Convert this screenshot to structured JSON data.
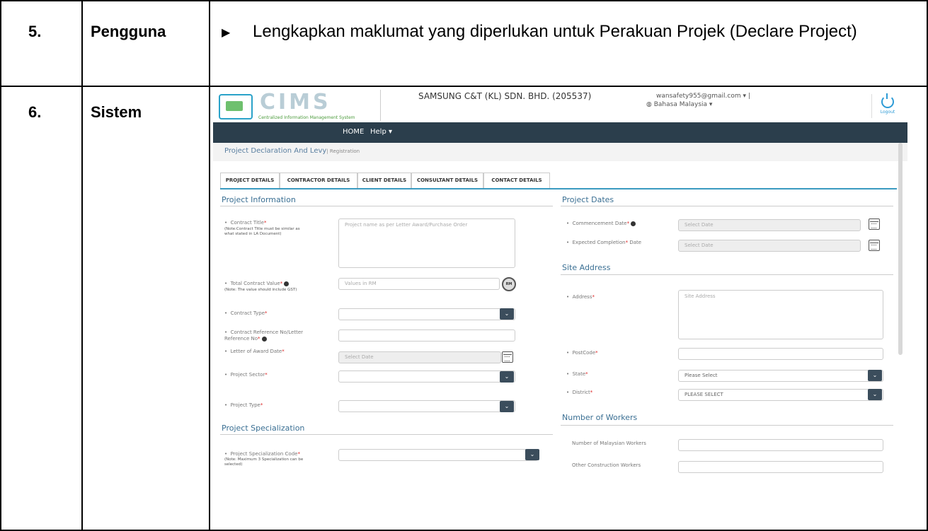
{
  "rows": [
    {
      "num": "5.",
      "actor": "Pengguna",
      "desc": "Lengkapkan maklumat yang diperlukan untuk Perakuan Projek (Declare Project)"
    },
    {
      "num": "6.",
      "actor": "Sistem"
    }
  ],
  "screen": {
    "logo": {
      "title": "CIMS",
      "subtitle": "Centralized Information Management System"
    },
    "company": "SAMSUNG C&T (KL) SDN. BHD. (205537)",
    "user_email": "wansafety955@gmail.com ▾ |",
    "language": "Bahasa Malaysia ▾",
    "logout": "Logout",
    "nav": {
      "home": "HOME",
      "help": "Help ▾"
    },
    "breadcrumb": {
      "title": "Project Declaration And Levy",
      "sub": "| Registration"
    },
    "tabs": [
      "PROJECT DETAILS",
      "CONTRACTOR DETAILS",
      "CLIENT DETAILS",
      "CONSULTANT DETAILS",
      "CONTACT DETAILS"
    ],
    "left": {
      "project_information": "Project Information",
      "contract_title": "Contract Title",
      "contract_title_note": "(Note:Contract Title must be similar as what stated in LA Document)",
      "contract_title_placeholder": "Project name as per Letter Award/Purchase Order",
      "total_contract_value": "Total Contract Value",
      "total_contract_value_note": "(Note: The value should include GST)",
      "total_contract_value_placeholder": "Values in RM",
      "rm_badge": "RM",
      "contract_type": "Contract Type",
      "contract_ref": "Contract Reference No/Letter Reference No",
      "letter_award_date": "Letter of Award Date",
      "letter_award_placeholder": "Select Date",
      "project_sector": "Project Sector",
      "project_type": "Project Type",
      "project_specialization": "Project Specialization",
      "spec_code": "Project Specialization Code",
      "spec_code_note": "(Note: Maximum 3 Specialization can be selected)"
    },
    "right": {
      "project_dates": "Project Dates",
      "commencement_date": "Commencement Date",
      "expected_completion": "Expected Completion",
      "date_word": "Date",
      "select_date": "Select Date",
      "site_address": "Site Address",
      "address": "Address",
      "address_placeholder": "Site Address",
      "postcode": "PostCode",
      "state": "State",
      "state_value": "Please Select",
      "district": "District",
      "district_value": "PLEASE SELECT",
      "number_of_workers": "Number of Workers",
      "malaysian_workers": "Number of Malaysian Workers",
      "other_workers": "Other Construction Workers"
    },
    "required_mark": "*"
  },
  "colors": {
    "nav": "#2b3e4c",
    "accent": "#3a9ac0",
    "title": "#3a6f93"
  }
}
